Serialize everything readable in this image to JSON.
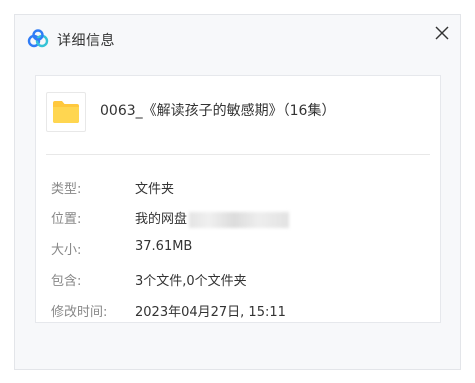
{
  "dialog": {
    "title": "详细信息",
    "close_symbol": "✕"
  },
  "file": {
    "name": "0063_《解读孩子的敏感期》（16集）",
    "icon": "folder-icon"
  },
  "details": {
    "type": {
      "label": "类型:",
      "value": "文件夹"
    },
    "location": {
      "label": "位置:",
      "value": "我的网盘"
    },
    "size": {
      "label": "大小:",
      "value": "37.61MB"
    },
    "contains": {
      "label": "包含:",
      "value": "3个文件,0个文件夹"
    },
    "modified": {
      "label": "修改时间:",
      "value": "2023年04月27日, 15:11"
    }
  },
  "colors": {
    "folder": "#ffd04d",
    "logo_blue": "#2f7cf6",
    "logo_teal": "#35c3d6"
  }
}
